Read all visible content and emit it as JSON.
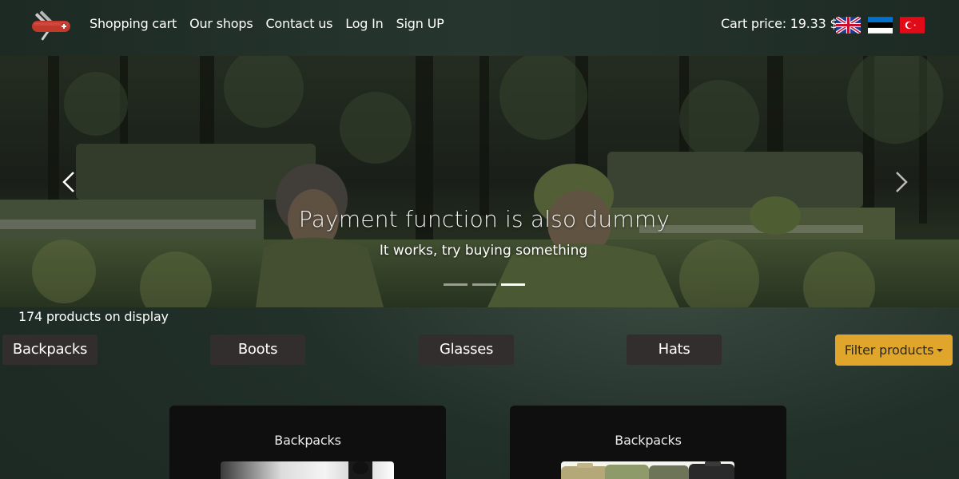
{
  "navbar": {
    "links": [
      "Shopping cart",
      "Our shops",
      "Contact us",
      "Log In",
      "Sign UP"
    ],
    "cart_price": "Cart price: 19.33 $",
    "flags": [
      "uk-flag-icon",
      "estonia-flag-icon",
      "turkey-flag-icon"
    ]
  },
  "carousel": {
    "title": "Payment function is also dummy",
    "subtitle": "It works, try buying something",
    "slides": 3,
    "active_slide": 3
  },
  "products": {
    "count_text": "174 products on display",
    "categories": [
      "Backpacks",
      "Boots",
      "Glasses",
      "Hats"
    ],
    "filter_label": "Filter products",
    "cards": [
      {
        "title": "Backpacks"
      },
      {
        "title": "Backpacks"
      }
    ]
  },
  "colors": {
    "accent": "#e0a62c",
    "nav_bg": "#22302a",
    "button_bg": "#322e2e",
    "card_bg": "#0e0f0e"
  }
}
